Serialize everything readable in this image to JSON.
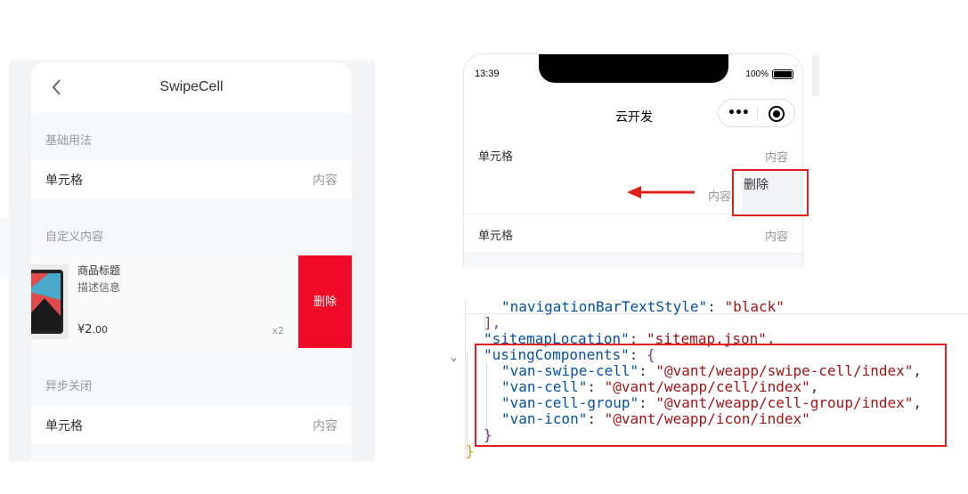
{
  "left": {
    "nav_title": "SwipeCell",
    "section_basic": "基础用法",
    "basic_cell": {
      "label": "单元格",
      "value": "内容"
    },
    "section_custom": "自定义内容",
    "card": {
      "title": "商品标题",
      "desc": "描述信息",
      "price_symbol": "¥",
      "price_int": "2",
      "price_dec": ".00",
      "num": "x2"
    },
    "delete_label": "删除",
    "section_async": "异步关闭",
    "async_cell": {
      "label": "单元格",
      "value": "内容"
    }
  },
  "right": {
    "time": "13:39",
    "battery": "100%",
    "nav_title": "云开发",
    "capsule_dots": "•••",
    "cell1": {
      "label": "单元格",
      "value": "内容"
    },
    "cell2": {
      "value": "内容"
    },
    "delete_label": "删除",
    "cell3": {
      "label": "单元格",
      "value": "内容"
    }
  },
  "code": {
    "l1k": "\"navigationBarTextStyle\"",
    "l1v": "\"black\"",
    "l2": "],",
    "l3k": "\"sitemapLocation\"",
    "l3v": "\"sitemap.json\"",
    "l4k": "\"usingComponents\"",
    "l5k": "\"van-swipe-cell\"",
    "l5v": "\"@vant/weapp/swipe-cell/index\"",
    "l6k": "\"van-cell\"",
    "l6v": "\"@vant/weapp/cell/index\"",
    "l7k": "\"van-cell-group\"",
    "l7v": "\"@vant/weapp/cell-group/index\"",
    "l8k": "\"van-icon\"",
    "l8v": "\"@vant/weapp/icon/index\"",
    "l9": "}",
    "l10": "}"
  },
  "colors": {
    "delete_red": "#ee0a24",
    "highlight_box": "#e02020",
    "arrow": "#e02020"
  }
}
